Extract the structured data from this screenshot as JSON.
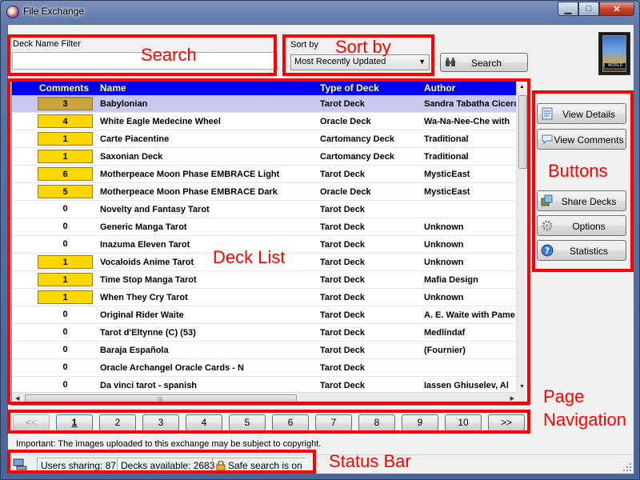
{
  "window": {
    "title": "File Exchange",
    "min_label": "▁",
    "max_label": "□",
    "close_label": "✕"
  },
  "filter": {
    "label": "Deck Name Filter",
    "value": "",
    "placeholder": ""
  },
  "sort": {
    "label": "Sort by",
    "selected": "Most Recently Updated"
  },
  "search_button": {
    "label": "Search"
  },
  "deck_image": {
    "caption": "WORLD"
  },
  "grid": {
    "columns": {
      "comments": "Comments",
      "name": "Name",
      "type": "Type of Deck",
      "author": "Author"
    },
    "rows": [
      {
        "comments": "3",
        "name": "Babylonian",
        "type": "Tarot Deck",
        "author": "Sandra Tabatha Cicero"
      },
      {
        "comments": "4",
        "name": "White Eagle Medecine Wheel",
        "type": "Oracle Deck",
        "author": "Wa-Na-Nee-Che with"
      },
      {
        "comments": "1",
        "name": "Carte Piacentine",
        "type": "Cartomancy Deck",
        "author": "Traditional"
      },
      {
        "comments": "1",
        "name": "Saxonian Deck",
        "type": "Cartomancy Deck",
        "author": "Traditional"
      },
      {
        "comments": "6",
        "name": "Motherpeace Moon Phase EMBRACE Light",
        "type": "Tarot Deck",
        "author": "MysticEast"
      },
      {
        "comments": "5",
        "name": "Motherpeace Moon Phase EMBRACE Dark",
        "type": "Oracle Deck",
        "author": "MysticEast"
      },
      {
        "comments": "0",
        "name": "Novelty and Fantasy Tarot",
        "type": "Tarot Deck",
        "author": ""
      },
      {
        "comments": "0",
        "name": "Generic Manga Tarot",
        "type": "Tarot Deck",
        "author": "Unknown"
      },
      {
        "comments": "0",
        "name": "Inazuma Eleven Tarot",
        "type": "Tarot Deck",
        "author": "Unknown"
      },
      {
        "comments": "1",
        "name": "Vocaloids Anime Tarot",
        "type": "Tarot Deck",
        "author": "Unknown"
      },
      {
        "comments": "1",
        "name": "Time Stop Manga Tarot",
        "type": "Tarot Deck",
        "author": "Mafia Design"
      },
      {
        "comments": "1",
        "name": "When They Cry Tarot",
        "type": "Tarot Deck",
        "author": "Unknown"
      },
      {
        "comments": "0",
        "name": "Original Rider Waite",
        "type": "Tarot Deck",
        "author": "A. E. Waite with Pame"
      },
      {
        "comments": "0",
        "name": "Tarot d'Eltynne (C) (53)",
        "type": "Tarot Deck",
        "author": "Medlindaf"
      },
      {
        "comments": "0",
        "name": "Baraja Española",
        "type": "Tarot Deck",
        "author": "(Fournier)"
      },
      {
        "comments": "0",
        "name": "Oracle Archangel Oracle Cards - N",
        "type": "Tarot Deck",
        "author": ""
      },
      {
        "comments": "0",
        "name": "Da vinci tarot - spanish",
        "type": "Tarot Deck",
        "author": "Iassen Ghiuselev, Al"
      }
    ]
  },
  "side_buttons": {
    "view_details": "View Details",
    "view_comments": "View Comments",
    "share_decks": "Share Decks",
    "options": "Options",
    "statistics": "Statistics"
  },
  "pager": {
    "prev": "<<",
    "pages": [
      "1",
      "2",
      "3",
      "4",
      "5",
      "6",
      "7",
      "8",
      "9",
      "10"
    ],
    "next": ">>",
    "current": "1"
  },
  "copyright_notice": "Important: The images uploaded to this exchange may be subject to copyright.",
  "status": {
    "users_sharing": "Users sharing: 87",
    "decks_available": "Decks available: 2683",
    "safe_search": "Safe search is on"
  },
  "annotations": {
    "search": "Search",
    "sort_by": "Sort by",
    "deck_list": "Deck List",
    "buttons": "Buttons",
    "page_navigation_line1": "Page",
    "page_navigation_line2": "Navigation",
    "status_bar": "Status Bar",
    "color": "#ff0000"
  },
  "colors": {
    "header_bg": "#0000ee",
    "header_text": "#ffff88",
    "comment_badge": "#ffd700",
    "selected_row": "#c8c8f0"
  }
}
